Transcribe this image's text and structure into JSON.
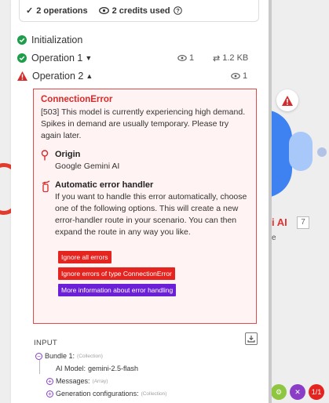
{
  "summary": {
    "operations": "2 operations",
    "credits": "2 credits used"
  },
  "rows": {
    "init": {
      "label": "Initialization"
    },
    "op1": {
      "label": "Operation 1",
      "bundles": "1",
      "size": "1.2 KB"
    },
    "op2": {
      "label": "Operation 2",
      "bundles": "1"
    }
  },
  "error": {
    "title": "ConnectionError",
    "message": "[503] This model is currently experiencing high demand. Spikes in demand are usually temporary. Please try again later.",
    "origin_heading": "Origin",
    "origin_value": "Google Gemini AI",
    "handler_heading": "Automatic error handler",
    "handler_text": "If you want to handle this error automatically, choose one of the following options. This will create a new error-handler route in your scenario. You can then expand the route in any way you like.",
    "buttons": {
      "ignore_all": "Ignore all errors",
      "ignore_type": "Ignore errors of type ConnectionError",
      "more_info": "More information about error handling"
    }
  },
  "input": {
    "heading": "INPUT",
    "bundle_label": "Bundle 1:",
    "bundle_type": "(Collection)",
    "model_label": "AI Model:",
    "model_value": "gemini-2.5-flash",
    "messages_label": "Messages:",
    "messages_type": "(Array)",
    "genconf_label": "Generation configurations:",
    "genconf_type": "(Collection)"
  },
  "background": {
    "module_label": "i AI",
    "module_count": "7",
    "sub_label": "e",
    "badge_text": "1/1"
  },
  "colors": {
    "success": "#1e9e4a",
    "error": "#d62b2b",
    "primary": "#3d82f0",
    "purple": "#6b1fd6"
  }
}
